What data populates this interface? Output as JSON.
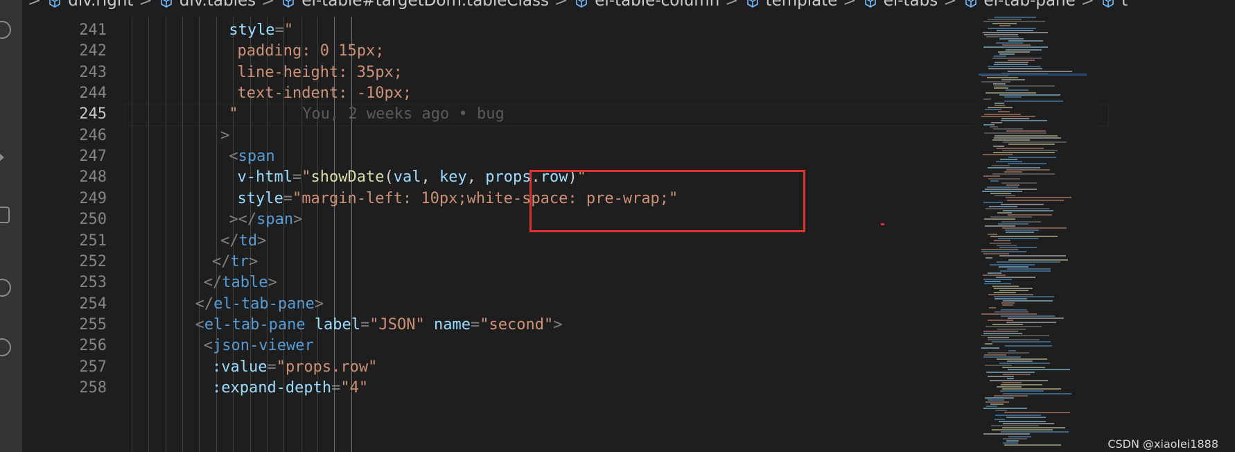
{
  "breadcrumb": [
    "div.right",
    "div.tables",
    "el-table#targetDom.tableClass",
    "el-table-column",
    "template",
    "el-tabs",
    "el-tab-pane",
    "t"
  ],
  "editor": {
    "current_line": 245,
    "blame": "You, 2 weeks ago • bug",
    "lines": [
      {
        "n": 241,
        "indent": 13,
        "tokens": [
          [
            "attr",
            "style"
          ],
          [
            "punc",
            "="
          ],
          [
            "str",
            "\""
          ]
        ]
      },
      {
        "n": 242,
        "indent": 14,
        "tokens": [
          [
            "str",
            "padding: 0 15px;"
          ]
        ]
      },
      {
        "n": 243,
        "indent": 14,
        "tokens": [
          [
            "str",
            "line-height: 35px;"
          ]
        ]
      },
      {
        "n": 244,
        "indent": 14,
        "tokens": [
          [
            "str",
            "text-indent: -10px;"
          ]
        ]
      },
      {
        "n": 245,
        "indent": 13,
        "tokens": [
          [
            "str",
            "\""
          ]
        ]
      },
      {
        "n": 246,
        "indent": 12,
        "tokens": [
          [
            "punc",
            ">"
          ]
        ]
      },
      {
        "n": 247,
        "indent": 13,
        "tokens": [
          [
            "punc",
            "<"
          ],
          [
            "tag",
            "span"
          ]
        ]
      },
      {
        "n": 248,
        "indent": 14,
        "tokens": [
          [
            "attr",
            "v-html"
          ],
          [
            "punc",
            "="
          ],
          [
            "str",
            "\""
          ],
          [
            "fn",
            "showDate"
          ],
          [
            "txt",
            "("
          ],
          [
            "attr",
            "val"
          ],
          [
            "txt",
            ", "
          ],
          [
            "attr",
            "key"
          ],
          [
            "txt",
            ", "
          ],
          [
            "attr",
            "props"
          ],
          [
            "txt",
            "."
          ],
          [
            "attr",
            "row"
          ],
          [
            "txt",
            ")"
          ],
          [
            "str",
            "\""
          ]
        ]
      },
      {
        "n": 249,
        "indent": 14,
        "tokens": [
          [
            "attr",
            "style"
          ],
          [
            "punc",
            "="
          ],
          [
            "str",
            "\"margin-left: 10px;white-space: pre-wrap;\""
          ]
        ]
      },
      {
        "n": 250,
        "indent": 13,
        "tokens": [
          [
            "punc",
            "></"
          ],
          [
            "tag",
            "span"
          ],
          [
            "punc",
            ">"
          ]
        ]
      },
      {
        "n": 251,
        "indent": 12,
        "tokens": [
          [
            "punc",
            "</"
          ],
          [
            "tag",
            "td"
          ],
          [
            "punc",
            ">"
          ]
        ]
      },
      {
        "n": 252,
        "indent": 11,
        "tokens": [
          [
            "punc",
            "</"
          ],
          [
            "tag",
            "tr"
          ],
          [
            "punc",
            ">"
          ]
        ]
      },
      {
        "n": 253,
        "indent": 10,
        "tokens": [
          [
            "punc",
            "</"
          ],
          [
            "tag",
            "table"
          ],
          [
            "punc",
            ">"
          ]
        ]
      },
      {
        "n": 254,
        "indent": 9,
        "tokens": [
          [
            "punc",
            "</"
          ],
          [
            "tag",
            "el-tab-pane"
          ],
          [
            "punc",
            ">"
          ]
        ]
      },
      {
        "n": 255,
        "indent": 9,
        "tokens": [
          [
            "punc",
            "<"
          ],
          [
            "tag",
            "el-tab-pane"
          ],
          [
            "txt",
            " "
          ],
          [
            "attr",
            "label"
          ],
          [
            "punc",
            "="
          ],
          [
            "str",
            "\"JSON\""
          ],
          [
            "txt",
            " "
          ],
          [
            "attr",
            "name"
          ],
          [
            "punc",
            "="
          ],
          [
            "str",
            "\"second\""
          ],
          [
            "punc",
            ">"
          ]
        ]
      },
      {
        "n": 256,
        "indent": 10,
        "tokens": [
          [
            "punc",
            "<"
          ],
          [
            "tag",
            "json-viewer"
          ]
        ]
      },
      {
        "n": 257,
        "indent": 11,
        "tokens": [
          [
            "attr",
            ":value"
          ],
          [
            "punc",
            "="
          ],
          [
            "str",
            "\"props.row\""
          ]
        ]
      },
      {
        "n": 258,
        "indent": 11,
        "tokens": [
          [
            "attr",
            ":expand-depth"
          ],
          [
            "punc",
            "="
          ],
          [
            "str",
            "\"4\""
          ]
        ]
      }
    ]
  },
  "colors": {
    "background": "#1e1e1e",
    "tag": "#569cd6",
    "attribute": "#9cdcfe",
    "string": "#ce9178",
    "function": "#dcdcaa",
    "punctuation": "#808080",
    "annotation_box": "#e03030"
  },
  "icons": [
    "symbol-class-icon",
    "activity-icon"
  ],
  "watermark": "CSDN @xiaolei1888"
}
